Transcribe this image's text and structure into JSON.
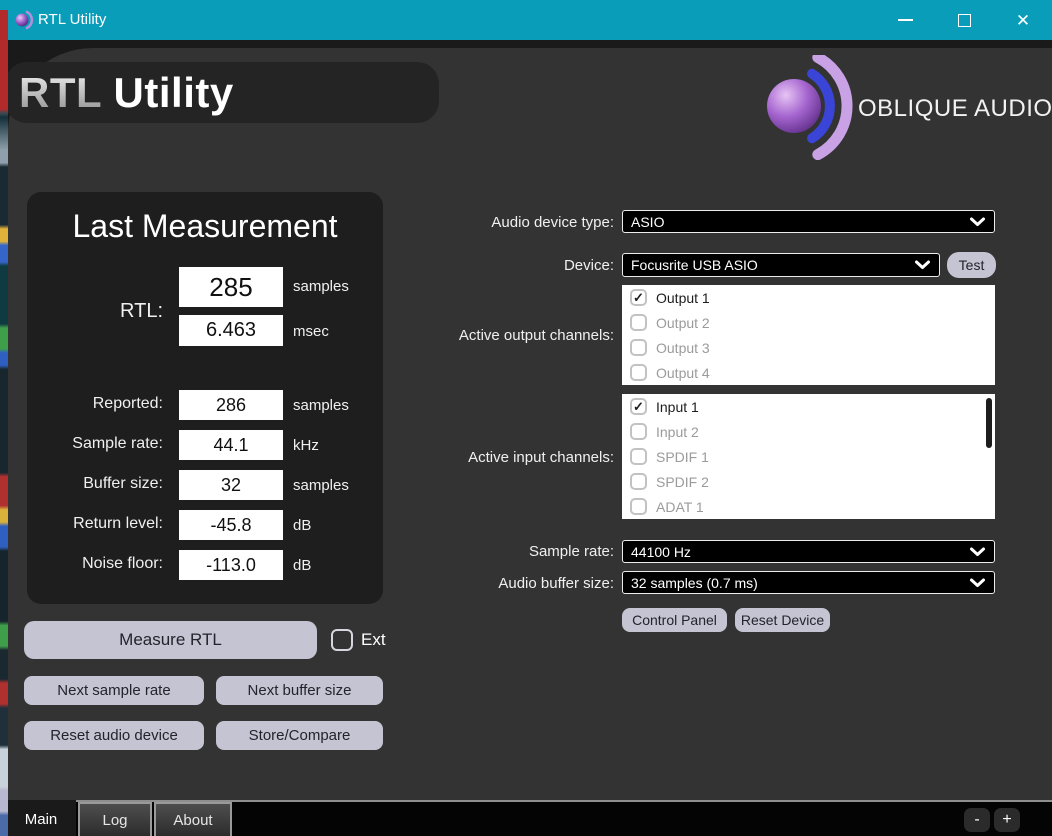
{
  "window": {
    "title": "RTL Utility"
  },
  "header": {
    "title_strong": "RTL",
    "title_light": " Utility",
    "brand": "OBLIQUE AUDIO"
  },
  "measurement": {
    "title": "Last Measurement",
    "rtl_label": "RTL:",
    "rtl_samples": "285",
    "rtl_samples_unit": "samples",
    "rtl_msec": "6.463",
    "rtl_msec_unit": "msec",
    "rows": [
      {
        "label": "Reported:",
        "value": "286",
        "unit": "samples"
      },
      {
        "label": "Sample rate:",
        "value": "44.1",
        "unit": "kHz"
      },
      {
        "label": "Buffer size:",
        "value": "32",
        "unit": "samples"
      },
      {
        "label": "Return level:",
        "value": "-45.8",
        "unit": "dB"
      },
      {
        "label": "Noise floor:",
        "value": "-113.0",
        "unit": "dB"
      }
    ]
  },
  "actions": {
    "measure": "Measure RTL",
    "ext_label": "Ext",
    "ext_checked": false,
    "next_sample_rate": "Next sample rate",
    "next_buffer_size": "Next buffer size",
    "reset_audio_device": "Reset audio device",
    "store_compare": "Store/Compare"
  },
  "device": {
    "audio_device_type": {
      "label": "Audio device type:",
      "value": "ASIO"
    },
    "device_select": {
      "label": "Device:",
      "value": "Focusrite USB ASIO",
      "test_label": "Test"
    },
    "output_channels": {
      "label": "Active output channels:",
      "items": [
        {
          "label": "Output 1",
          "checked": true
        },
        {
          "label": "Output 2",
          "checked": false
        },
        {
          "label": "Output 3",
          "checked": false
        },
        {
          "label": "Output 4",
          "checked": false
        }
      ]
    },
    "input_channels": {
      "label": "Active input channels:",
      "items": [
        {
          "label": "Input 1",
          "checked": true
        },
        {
          "label": "Input 2",
          "checked": false
        },
        {
          "label": "SPDIF 1",
          "checked": false
        },
        {
          "label": "SPDIF 2",
          "checked": false
        },
        {
          "label": "ADAT 1",
          "checked": false
        }
      ]
    },
    "sample_rate": {
      "label": "Sample rate:",
      "value": "44100 Hz"
    },
    "buffer_size": {
      "label": "Audio buffer size:",
      "value": "32 samples (0.7 ms)"
    },
    "control_panel": "Control Panel",
    "reset_device": "Reset Device"
  },
  "tabs": [
    {
      "label": "Main",
      "active": true
    },
    {
      "label": "Log",
      "active": false
    },
    {
      "label": "About",
      "active": false
    }
  ],
  "zoom_controls": {
    "minus": "-",
    "plus": "+"
  },
  "window_controls": {
    "close": "✕"
  },
  "check_glyph": "✓",
  "colors": {
    "titlebar": "#0a9dba",
    "surface": "#333333",
    "panel": "#1e1e1e",
    "button": "#c5c4d2",
    "logo_sphere": "#9a5cc8",
    "logo_arc_inner": "#3a44d6",
    "logo_arc_outer": "#c9a2e6"
  }
}
